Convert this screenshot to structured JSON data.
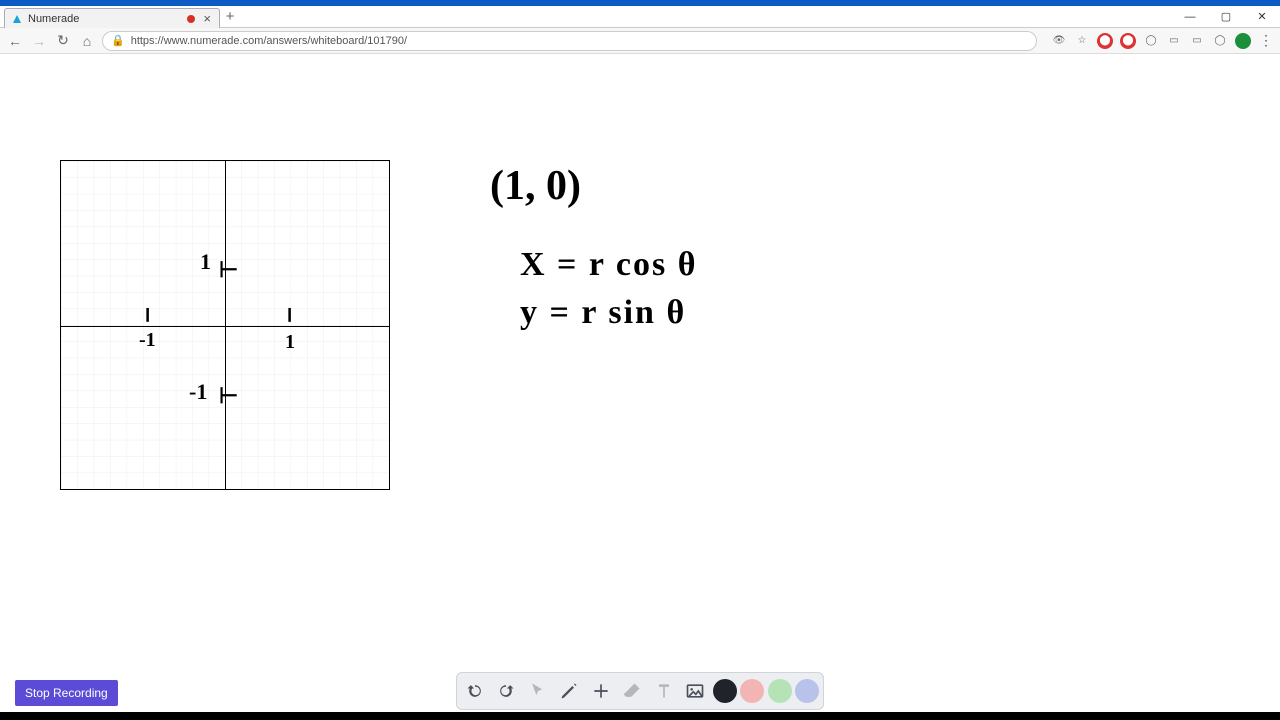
{
  "window": {
    "tab_title": "Numerade",
    "url": "https://www.numerade.com/answers/whiteboard/101790/",
    "minimize": "—",
    "maximize": "▢",
    "close": "✕",
    "new_tab": "+",
    "tab_close": "×"
  },
  "nav": {
    "back": "←",
    "forward": "→",
    "reload": "↻",
    "home": "⌂",
    "secure": "🔒",
    "reader": "👁",
    "star": "☆",
    "menu": "⋮"
  },
  "graph": {
    "tick_plus_y": "1",
    "tick_plus_y_mark": "⊢",
    "tick_plus_x_mark": "╵",
    "tick_plus_x": "1",
    "tick_minus_x_mark": "╵",
    "tick_minus_x": "-1",
    "tick_minus_y": "-1",
    "tick_minus_y_mark": "⊢"
  },
  "equations": {
    "point": "(1, 0)",
    "x": "X = r cos θ",
    "y": "y = r sin θ"
  },
  "stop_button": "Stop Recording",
  "toolbar": {
    "undo": "undo",
    "redo": "redo",
    "pointer": "pointer",
    "pen": "pen",
    "add": "add",
    "eraser": "eraser",
    "text": "text",
    "image": "image",
    "color_black": "#20232a",
    "color_red": "#f3b4b4",
    "color_green": "#b6e3b6",
    "color_purple": "#b8c2ea"
  }
}
